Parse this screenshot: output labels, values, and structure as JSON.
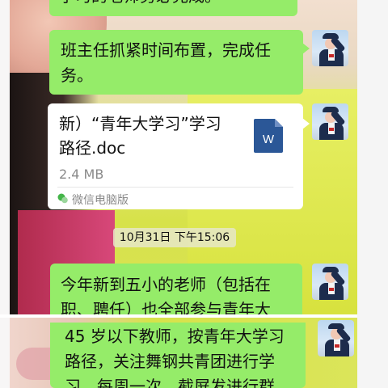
{
  "chat": {
    "messages": [
      {
        "type": "text",
        "text": "学习的老师务必完成。"
      },
      {
        "type": "text",
        "lines": [
          "班主任抓紧时间布置，完成任",
          "务。"
        ]
      },
      {
        "type": "file",
        "name_lines": [
          "新）“青年大学习”学习",
          "路径.doc"
        ],
        "size": "2.4 MB",
        "source": "微信电脑版",
        "file_icon": "word-doc-icon",
        "icon_letter": "W"
      },
      {
        "type": "time",
        "text": "10月31日 下午15:06"
      },
      {
        "type": "text",
        "lines": [
          "今年新到五小的老师（包括在",
          "职、聘任）也全部参与青年大"
        ]
      },
      {
        "type": "text",
        "lines": [
          "45 岁以下教师，按青年大学习",
          "路径，关注舞钢共青团进行学",
          "习，每周一次，截屏发进行群"
        ]
      }
    ]
  },
  "colors": {
    "bubble_green": "#95ec69",
    "file_bubble": "#ffffff",
    "word_blue": "#2b5797"
  }
}
